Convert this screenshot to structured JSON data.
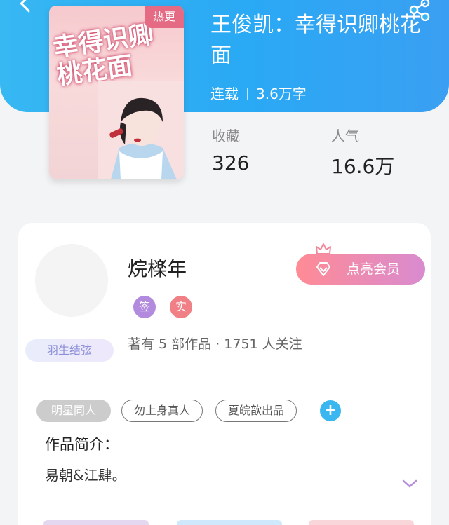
{
  "book": {
    "title": "王俊凯：幸得识卿桃花面",
    "cover_badge": "热更",
    "cover_title": "幸得识卿桃花面",
    "status": "连载",
    "word_count": "3.6万字"
  },
  "stats": {
    "favorites_label": "收藏",
    "favorites_value": "326",
    "popularity_label": "人气",
    "popularity_value": "16.6万"
  },
  "author": {
    "name": "烷檪年",
    "badges": [
      "签",
      "实"
    ],
    "meta": "著有 5 部作品 · 1751 人关注",
    "avatar_tag": "羽生结弦",
    "vip_button": "点亮会员"
  },
  "tags": [
    "明星同人",
    "勿上身真人",
    "夏皖歆出品"
  ],
  "intro": {
    "heading": "作品简介：",
    "text": "易朝&江肆。"
  },
  "colors": {
    "header_blue": "#2aa9f4",
    "accent_blue": "#3ab6f0",
    "badge_sign": "#b38bde",
    "badge_real": "#f07f86"
  },
  "icons": {
    "back": "chevron-left-icon",
    "share": "share-icon",
    "diamond": "diamond-icon",
    "crown": "crown-icon",
    "add": "plus-icon",
    "expand": "chevron-down-icon"
  }
}
